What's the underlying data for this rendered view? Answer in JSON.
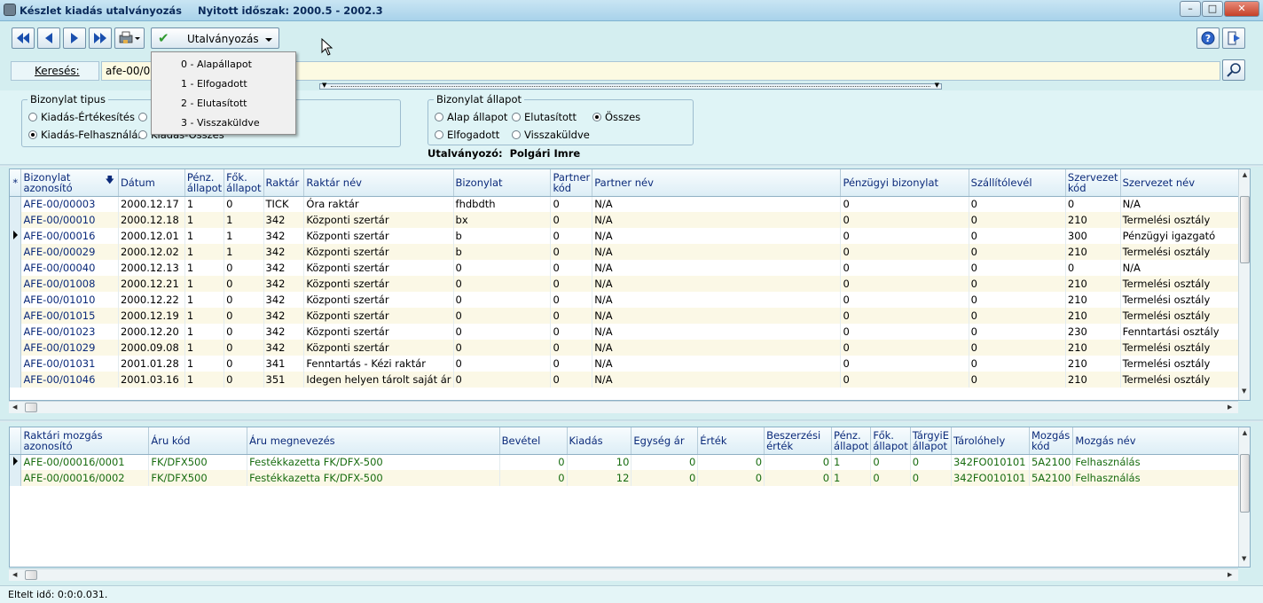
{
  "window": {
    "title": "Készlet kiadás utalványozás",
    "period": "Nyitott időszak: 2000.5 - 2002.3"
  },
  "toolbar": {
    "utalvanyozas_label": "Utalványozás"
  },
  "dropdown": {
    "items": [
      "0 - Alapállapot",
      "1 - Elfogadott",
      "2 - Elutasított",
      "3 - Visszaküldve"
    ]
  },
  "search": {
    "label": "Keresés:",
    "value": "afe-00/00"
  },
  "filter": {
    "type_legend": "Bizonylat tipus",
    "type_options": [
      "Kiadás-Értékesítés",
      "Kiadás-Felhasználás",
      "Kiadás-Összes"
    ],
    "type_selected": "Kiadás-Felhasználás",
    "status_legend": "Bizonylat állapot",
    "status_options": [
      "Alap állapot",
      "Elutasított",
      "Összes",
      "Elfogadott",
      "Visszaküldve"
    ],
    "status_selected": "Összes",
    "approver": "Utalványozó:  Polgári Imre"
  },
  "grid1": {
    "headers": [
      "*",
      "Bizonylat azonosító",
      "Dátum",
      "Pénz. állapot",
      "Fők. állapot",
      "Raktár",
      "Raktár név",
      "Bizonylat",
      "Partner kód",
      "Partner név",
      "Pénzügyi bizonylat",
      "Szállítólevél",
      "Szervezet kód",
      "Szervezet név"
    ],
    "rows": [
      [
        "AFE-00/00003",
        "2000.12.17",
        "1",
        "0",
        "TICK",
        "Óra raktár",
        "fhdbdth",
        "0",
        "N/A",
        "0",
        "0",
        "0",
        "N/A"
      ],
      [
        "AFE-00/00010",
        "2000.12.18",
        "1",
        "1",
        "342",
        "Központi szertár",
        "bx",
        "0",
        "N/A",
        "0",
        "0",
        "210",
        "Termelési osztály"
      ],
      [
        "AFE-00/00016",
        "2000.12.01",
        "1",
        "1",
        "342",
        "Központi szertár",
        "b",
        "0",
        "N/A",
        "0",
        "0",
        "300",
        "Pénzügyi igazgató"
      ],
      [
        "AFE-00/00029",
        "2000.12.02",
        "1",
        "1",
        "342",
        "Központi szertár",
        "b",
        "0",
        "N/A",
        "0",
        "0",
        "210",
        "Termelési osztály"
      ],
      [
        "AFE-00/00040",
        "2000.12.13",
        "1",
        "0",
        "342",
        "Központi szertár",
        "0",
        "0",
        "N/A",
        "0",
        "0",
        "0",
        "N/A"
      ],
      [
        "AFE-00/01008",
        "2000.12.21",
        "1",
        "0",
        "342",
        "Központi szertár",
        "0",
        "0",
        "N/A",
        "0",
        "0",
        "210",
        "Termelési osztály"
      ],
      [
        "AFE-00/01010",
        "2000.12.22",
        "1",
        "0",
        "342",
        "Központi szertár",
        "0",
        "0",
        "N/A",
        "0",
        "0",
        "210",
        "Termelési osztály"
      ],
      [
        "AFE-00/01015",
        "2000.12.19",
        "1",
        "0",
        "342",
        "Központi szertár",
        "0",
        "0",
        "N/A",
        "0",
        "0",
        "210",
        "Termelési osztály"
      ],
      [
        "AFE-00/01023",
        "2000.12.20",
        "1",
        "0",
        "342",
        "Központi szertár",
        "0",
        "0",
        "N/A",
        "0",
        "0",
        "230",
        "Fenntartási osztály"
      ],
      [
        "AFE-00/01029",
        "2000.09.08",
        "1",
        "0",
        "342",
        "Központi szertár",
        "0",
        "0",
        "N/A",
        "0",
        "0",
        "210",
        "Termelési osztály"
      ],
      [
        "AFE-00/01031",
        "2001.01.28",
        "1",
        "0",
        "341",
        "Fenntartás - Kézi raktár",
        "0",
        "0",
        "N/A",
        "0",
        "0",
        "210",
        "Termelési osztály"
      ],
      [
        "AFE-00/01046",
        "2001.03.16",
        "1",
        "0",
        "351",
        "Idegen helyen tárolt saját ár",
        "0",
        "0",
        "N/A",
        "0",
        "0",
        "210",
        "Termelési osztály"
      ]
    ],
    "current_row": 2
  },
  "grid2": {
    "headers": [
      "",
      "Raktári mozgás azonosító",
      "Áru kód",
      "Áru megnevezés",
      "Bevétel",
      "Kiadás",
      "Egység ár",
      "Érték",
      "Beszerzési érték",
      "Pénz. állapot",
      "Fők. állapot",
      "TárgyiE állapot",
      "Tárolóhely",
      "Mozgás kód",
      "Mozgás név"
    ],
    "rows": [
      [
        "AFE-00/00016/0001",
        "FK/DFX500",
        "Festékkazetta FK/DFX-500",
        "0",
        "10",
        "0",
        "0",
        "0",
        "1",
        "0",
        "0",
        "342FO010101",
        "5A2100",
        "Felhasználás"
      ],
      [
        "AFE-00/00016/0002",
        "FK/DFX500",
        "Festékkazetta FK/DFX-500",
        "0",
        "12",
        "0",
        "0",
        "0",
        "1",
        "0",
        "0",
        "342FO010101",
        "5A2100",
        "Felhasználás"
      ]
    ],
    "current_row": 0
  },
  "status": {
    "elapsed": "Eltelt idő: 0:0:0.031."
  },
  "colors": {
    "background": "#d4eef0",
    "header_text": "#0b2a7a",
    "row_alt": "#fbf8e6",
    "detail_text": "#186c10"
  }
}
